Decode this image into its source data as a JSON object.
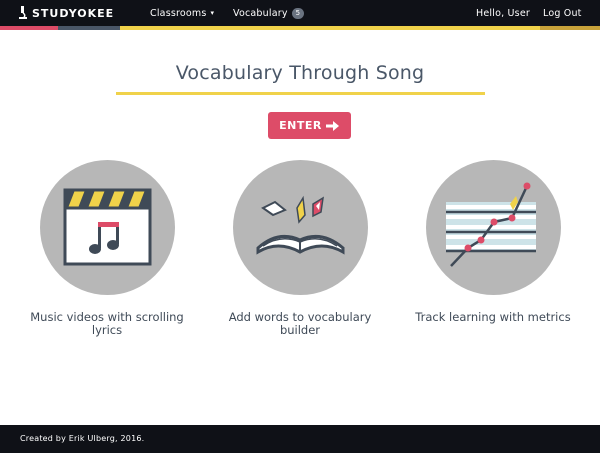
{
  "navbar": {
    "brand": "STUDYOKEE",
    "classrooms_label": "Classrooms",
    "vocabulary_label": "Vocabulary",
    "vocabulary_count": "5",
    "greeting": "Hello, User",
    "logout_label": "Log Out"
  },
  "colors": {
    "navbar_bg": "#0f1117",
    "accent_pink": "#dd4c68",
    "accent_yellow": "#f0d24a",
    "accent_slate": "#4a5768",
    "circle_gray": "#b7b7b7"
  },
  "hero": {
    "title": "Vocabulary Through Song",
    "enter_label": "ENTER"
  },
  "features": [
    {
      "icon": "clapperboard-music-icon",
      "caption_line1": "Music videos with scrolling",
      "caption_line2": "lyrics"
    },
    {
      "icon": "open-book-icon",
      "caption_line1": "Add words to vocabulary",
      "caption_line2": "builder"
    },
    {
      "icon": "metrics-chart-icon",
      "caption_line1": "Track learning with metrics",
      "caption_line2": ""
    }
  ],
  "footer": {
    "credit": "Created by Erik Ulberg, 2016."
  }
}
